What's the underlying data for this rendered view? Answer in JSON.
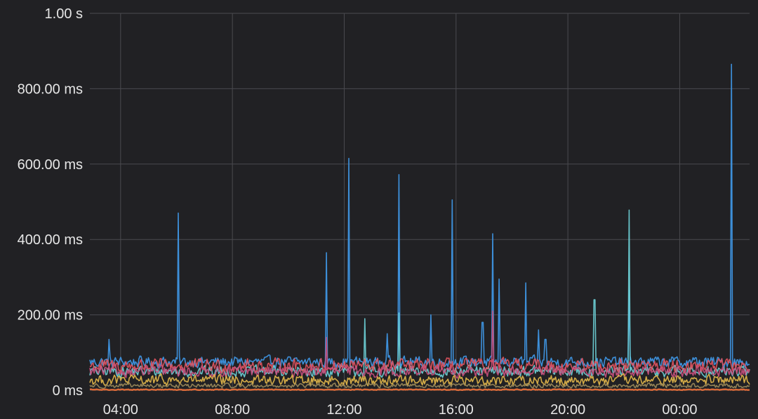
{
  "chart_data": {
    "type": "line",
    "title": "",
    "xlabel": "",
    "ylabel": "",
    "grid": true,
    "legend": "none",
    "x_ticks": [
      "04:00",
      "08:00",
      "12:00",
      "16:00",
      "20:00",
      "00:00"
    ],
    "x_tick_hours": [
      4,
      8,
      12,
      16,
      20,
      24
    ],
    "xlim_hours": [
      2.9,
      26.5
    ],
    "y_ticks": [
      "0 ms",
      "200.00 ms",
      "400.00 ms",
      "600.00 ms",
      "800.00 ms",
      "1.00 s"
    ],
    "y_tick_values": [
      0,
      200,
      400,
      600,
      800,
      1000
    ],
    "ylim": [
      0,
      1000
    ],
    "y_unit": "ms",
    "background": "#212124",
    "grid_color": "#4a4a4f",
    "series": [
      {
        "color": "#3d8fd9",
        "baseline_range": [
          55,
          95
        ],
        "spikes": [
          {
            "x": 3.6,
            "y": 135
          },
          {
            "x": 6.05,
            "y": 470
          },
          {
            "x": 11.35,
            "y": 365
          },
          {
            "x": 12.15,
            "y": 615
          },
          {
            "x": 13.55,
            "y": 150
          },
          {
            "x": 13.95,
            "y": 572
          },
          {
            "x": 15.1,
            "y": 200
          },
          {
            "x": 15.85,
            "y": 505
          },
          {
            "x": 16.95,
            "y": 180
          },
          {
            "x": 17.3,
            "y": 415
          },
          {
            "x": 17.55,
            "y": 295
          },
          {
            "x": 18.5,
            "y": 285
          },
          {
            "x": 18.95,
            "y": 160
          },
          {
            "x": 19.2,
            "y": 135
          },
          {
            "x": 22.2,
            "y": 265
          },
          {
            "x": 25.85,
            "y": 865
          }
        ]
      },
      {
        "color": "#6ccfd6",
        "baseline_range": [
          30,
          70
        ],
        "spikes": [
          {
            "x": 12.75,
            "y": 190
          },
          {
            "x": 13.95,
            "y": 205
          },
          {
            "x": 20.95,
            "y": 240
          },
          {
            "x": 22.2,
            "y": 478
          }
        ]
      },
      {
        "color": "#e0545f",
        "baseline_range": [
          40,
          90
        ],
        "spikes": []
      },
      {
        "color": "#c74f7d",
        "baseline_range": [
          30,
          70
        ],
        "spikes": [
          {
            "x": 11.35,
            "y": 140
          },
          {
            "x": 17.3,
            "y": 210
          }
        ]
      },
      {
        "color": "#e3b74b",
        "baseline_range": [
          8,
          45
        ],
        "spikes": []
      },
      {
        "color": "#9b8a5a",
        "baseline_range": [
          4,
          20
        ],
        "spikes": []
      },
      {
        "color": "#e8703b",
        "baseline_range": [
          0,
          3
        ],
        "spikes": []
      }
    ]
  }
}
